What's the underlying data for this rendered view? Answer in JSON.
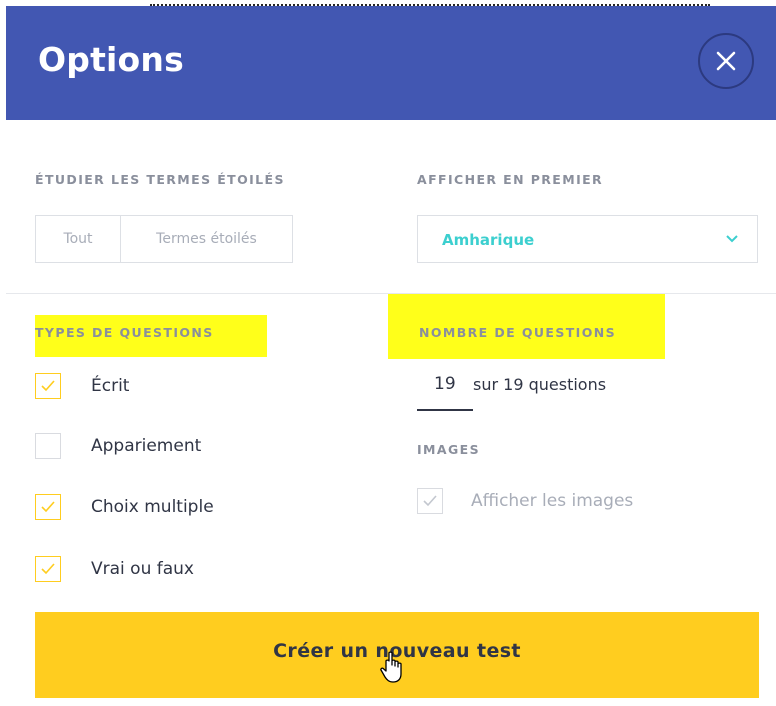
{
  "dialog": {
    "title": "Options",
    "close_icon": "close-icon",
    "accent_color": "#4257b2"
  },
  "study_starred": {
    "label": "ÉTUDIER LES TERMES ÉTOILÉS",
    "options": [
      "Tout",
      "Termes étoilés"
    ]
  },
  "show_first": {
    "label": "AFFICHER EN PREMIER",
    "selected": "Amharique",
    "value_color": "#3ccfcf"
  },
  "question_types": {
    "label": "TYPES DE QUESTIONS",
    "items": [
      {
        "label": "Écrit",
        "checked": true
      },
      {
        "label": "Appariement",
        "checked": false
      },
      {
        "label": "Choix multiple",
        "checked": true
      },
      {
        "label": "Vrai ou faux",
        "checked": true
      }
    ]
  },
  "question_count": {
    "label": "NOMBRE DE QUESTIONS",
    "value": "19",
    "suffix": "sur 19 questions"
  },
  "images": {
    "label": "IMAGES",
    "option_label": "Afficher les images",
    "checked": true
  },
  "footer": {
    "create_button": "Créer un nouveau test",
    "button_color": "#ffcd1f"
  },
  "highlight_color": "#ffff1a"
}
